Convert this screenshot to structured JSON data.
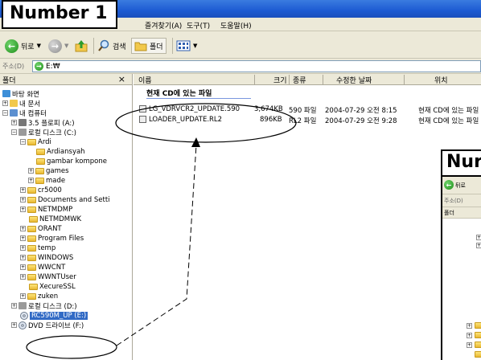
{
  "labels": {
    "main": "Number 1",
    "secondary": "Nur"
  },
  "menu": {
    "favorites": "즐겨찾기(A)",
    "tools": "도구(T)",
    "help": "도움말(H)"
  },
  "toolbar": {
    "back": "뒤로",
    "search": "검색",
    "folders": "폴더"
  },
  "address": {
    "label": "주소(D)",
    "path": "E:₩"
  },
  "left_pane": {
    "title": "폴더",
    "close": "×",
    "items": [
      "바탕 화면",
      "내 문서",
      "내 컴퓨터",
      "3.5 플로피 (A:)",
      "로컬 디스크 (C:)",
      "Ardi",
      "Ardiansyah",
      "gambar kompone",
      "games",
      "made",
      "cr5000",
      "Documents and Setti",
      "NETMDMP",
      "NETMDMWK",
      "ORANT",
      "Program Files",
      "temp",
      "WINDOWS",
      "WWCNT",
      "WWNTUser",
      "XecureSSL",
      "zuken",
      "로컬 디스크 (D:)",
      "RC590M_UP (E:)",
      "DVD 드라이브 (F:)"
    ]
  },
  "columns": {
    "name": "이름",
    "size": "크기",
    "type": "종류",
    "modified": "수정한 날짜",
    "location": "위치"
  },
  "group_title": "현재 CD에 있는 파일",
  "files": [
    {
      "name": "LG_VDRVCR2_UPDATE.590",
      "size": "3,674KB",
      "type": "590 파일",
      "modified": "2004-07-29 오전 8:15",
      "location": "현재 CD에 있는 파일"
    },
    {
      "name": "LOADER_UPDATE.RL2",
      "size": "896KB",
      "type": "RL2 파일",
      "modified": "2004-07-29 오전 9:28",
      "location": "현재 CD에 있는 파일"
    }
  ],
  "inset": {
    "back": "뒤로",
    "address": "주소(D)",
    "folders": "폴더"
  }
}
